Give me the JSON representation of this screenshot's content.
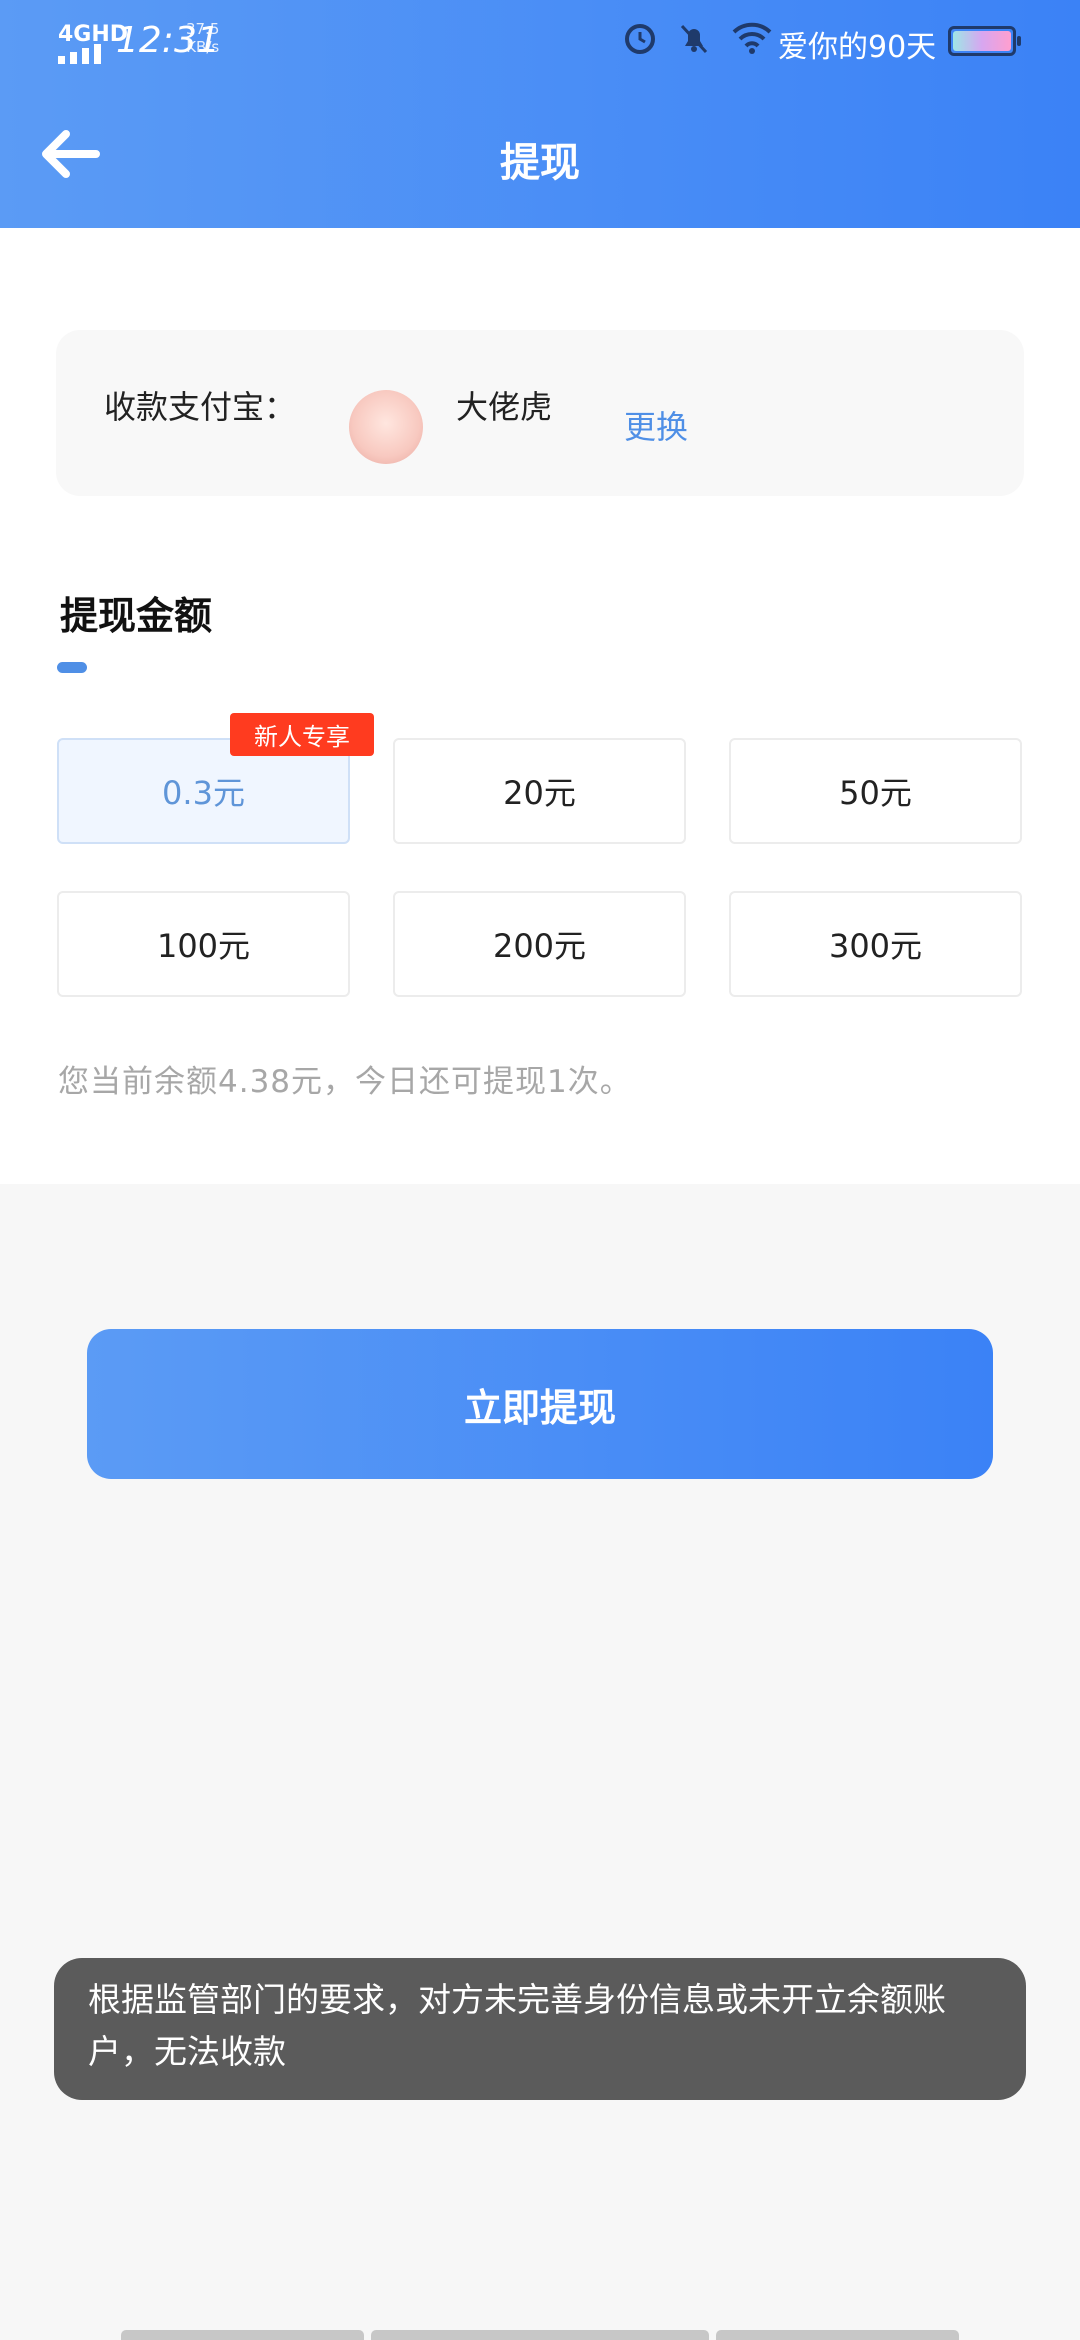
{
  "status_bar": {
    "network": "4GHD",
    "time": "12:31",
    "speed_value": "37.5",
    "speed_unit": "KB/s",
    "carrier": "爱你的90天",
    "icons": [
      "alarm-icon",
      "mute-bell-icon",
      "wifi-icon",
      "battery-icon"
    ]
  },
  "header": {
    "title": "提现",
    "back_icon": "arrow-left-icon"
  },
  "payee": {
    "label": "收款支付宝：",
    "name": "大佬虎",
    "change_label": "更换"
  },
  "section": {
    "title": "提现金额"
  },
  "amounts": [
    {
      "label": "0.3元",
      "selected": true
    },
    {
      "label": "20元",
      "selected": false
    },
    {
      "label": "50元",
      "selected": false
    },
    {
      "label": "100元",
      "selected": false
    },
    {
      "label": "200元",
      "selected": false
    },
    {
      "label": "300元",
      "selected": false
    }
  ],
  "badge": "新人专享",
  "balance_text": "您当前余额4.38元，今日还可提现1次。",
  "cta_label": "立即提现",
  "toast": "根据监管部门的要求，对方未完善身份信息或未开立余额账户，无法收款",
  "colors": {
    "accent": "#3b82f6",
    "badge": "#ff3b1f",
    "selected_text": "#5f95d8",
    "toast_bg": "#5b5b5b"
  }
}
